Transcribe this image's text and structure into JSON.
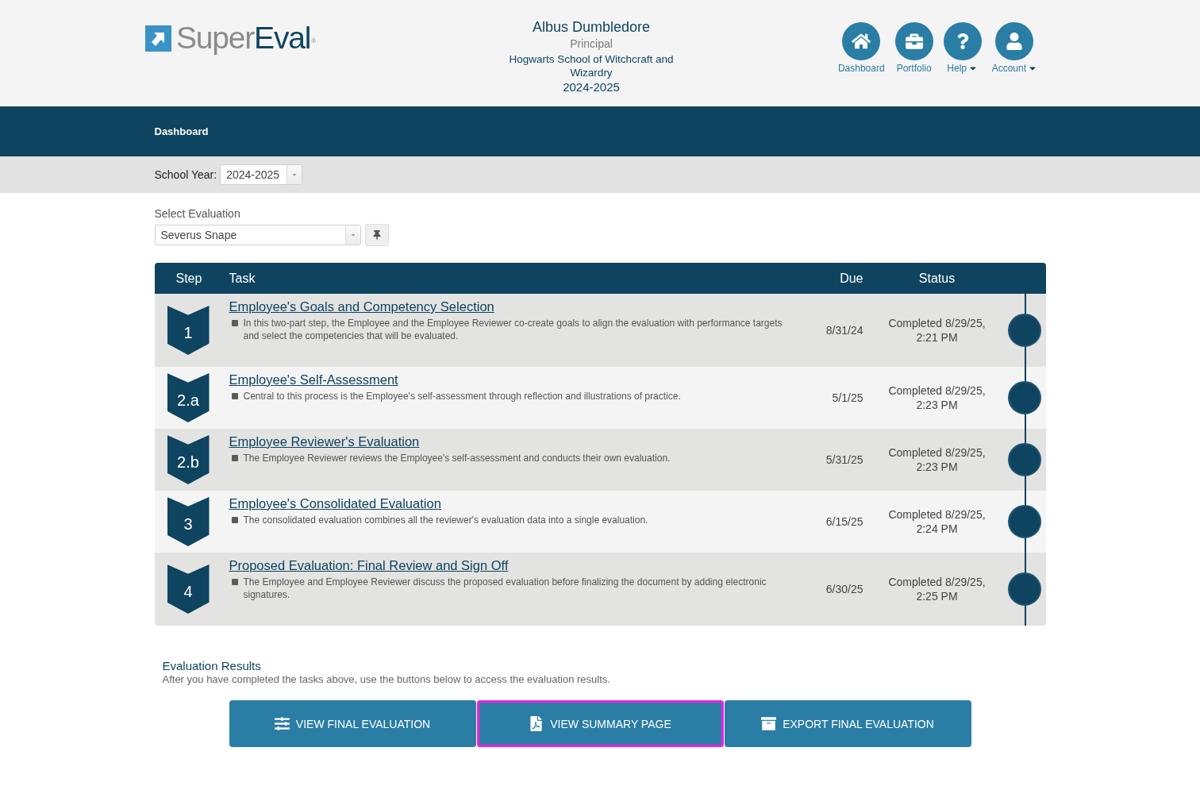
{
  "logo": {
    "first": "Super",
    "second": "Eval",
    "mark": "®"
  },
  "user": {
    "name": "Albus Dumbledore",
    "role": "Principal",
    "school": "Hogwarts School of Witchcraft and Wizardry",
    "year": "2024-2025"
  },
  "nav": [
    {
      "kind": "home",
      "label": "Dashboard",
      "menu": false
    },
    {
      "kind": "briefcase",
      "label": "Portfolio",
      "menu": false
    },
    {
      "kind": "help",
      "label": "Help",
      "menu": true
    },
    {
      "kind": "account",
      "label": "Account",
      "menu": true
    }
  ],
  "breadcrumb": "Dashboard",
  "school_year": {
    "label": "School Year:",
    "value": "2024-2025"
  },
  "evaluation": {
    "label": "Select Evaluation",
    "value": "Severus Snape"
  },
  "table": {
    "columns": [
      "Step",
      "Task",
      "Due",
      "Status"
    ],
    "rows": [
      {
        "step": "1",
        "task": "Employee's Goals and Competency Selection",
        "description": "In this two-part step, the Employee and the Employee Reviewer co-create goals to align the evaluation with performance targets and select the competencies that will be evaluated.",
        "due": "8/31/24",
        "status": "Completed 8/29/25, 2:21 PM",
        "done": true
      },
      {
        "step": "2.a",
        "task": "Employee's Self-Assessment",
        "description": "Central to this process is the Employee's self-assessment through reflection and illustrations of practice.",
        "due": "5/1/25",
        "status": "Completed 8/29/25, 2:23 PM",
        "done": true
      },
      {
        "step": "2.b",
        "task": "Employee Reviewer's Evaluation",
        "description": "The Employee Reviewer reviews the Employee's self-assessment and conducts their own evaluation.",
        "due": "5/31/25",
        "status": "Completed 8/29/25, 2:23 PM",
        "done": true
      },
      {
        "step": "3",
        "task": "Employee's Consolidated Evaluation",
        "description": "The consolidated evaluation combines all the reviewer's evaluation data into a single evaluation.",
        "due": "6/15/25",
        "status": "Completed 8/29/25, 2:24 PM",
        "done": true
      },
      {
        "step": "4",
        "task": "Proposed Evaluation: Final Review and Sign Off",
        "description": "The Employee and Employee Reviewer discuss the proposed evaluation before finalizing the document by adding electronic signatures.",
        "due": "6/30/25",
        "status": "Completed 8/29/25, 2:25 PM",
        "done": true
      }
    ]
  },
  "results": {
    "title": "Evaluation Results",
    "description": "After you have completed the tasks above, use the buttons below to access the evaluation results.",
    "buttons": [
      {
        "kind": "sliders",
        "label": "VIEW FINAL EVALUATION",
        "highlighted": false
      },
      {
        "kind": "pdf",
        "label": "VIEW SUMMARY PAGE",
        "highlighted": true
      },
      {
        "kind": "archive",
        "label": "EXPORT FINAL EVALUATION",
        "highlighted": false
      }
    ]
  }
}
